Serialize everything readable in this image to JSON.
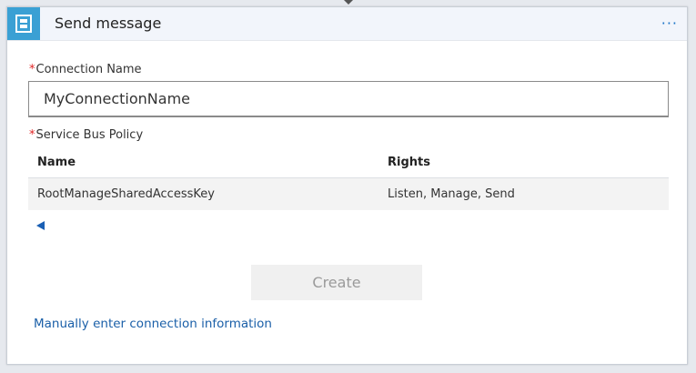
{
  "header": {
    "title": "Send message",
    "more_label": "···",
    "icon": "service-bus-icon",
    "accent_color": "#3aa0d4"
  },
  "connection": {
    "label": "Connection Name",
    "required_marker": "*",
    "value": "MyConnectionName"
  },
  "policy": {
    "label": "Service Bus Policy",
    "required_marker": "*",
    "columns": [
      "Name",
      "Rights"
    ],
    "rows": [
      {
        "name": "RootManageSharedAccessKey",
        "rights": "Listen, Manage, Send"
      }
    ]
  },
  "actions": {
    "create_label": "Create",
    "manual_link": "Manually enter connection information"
  },
  "colors": {
    "link": "#1a5fa8",
    "required": "#e02424",
    "disabled_text": "#9a9a9a"
  }
}
